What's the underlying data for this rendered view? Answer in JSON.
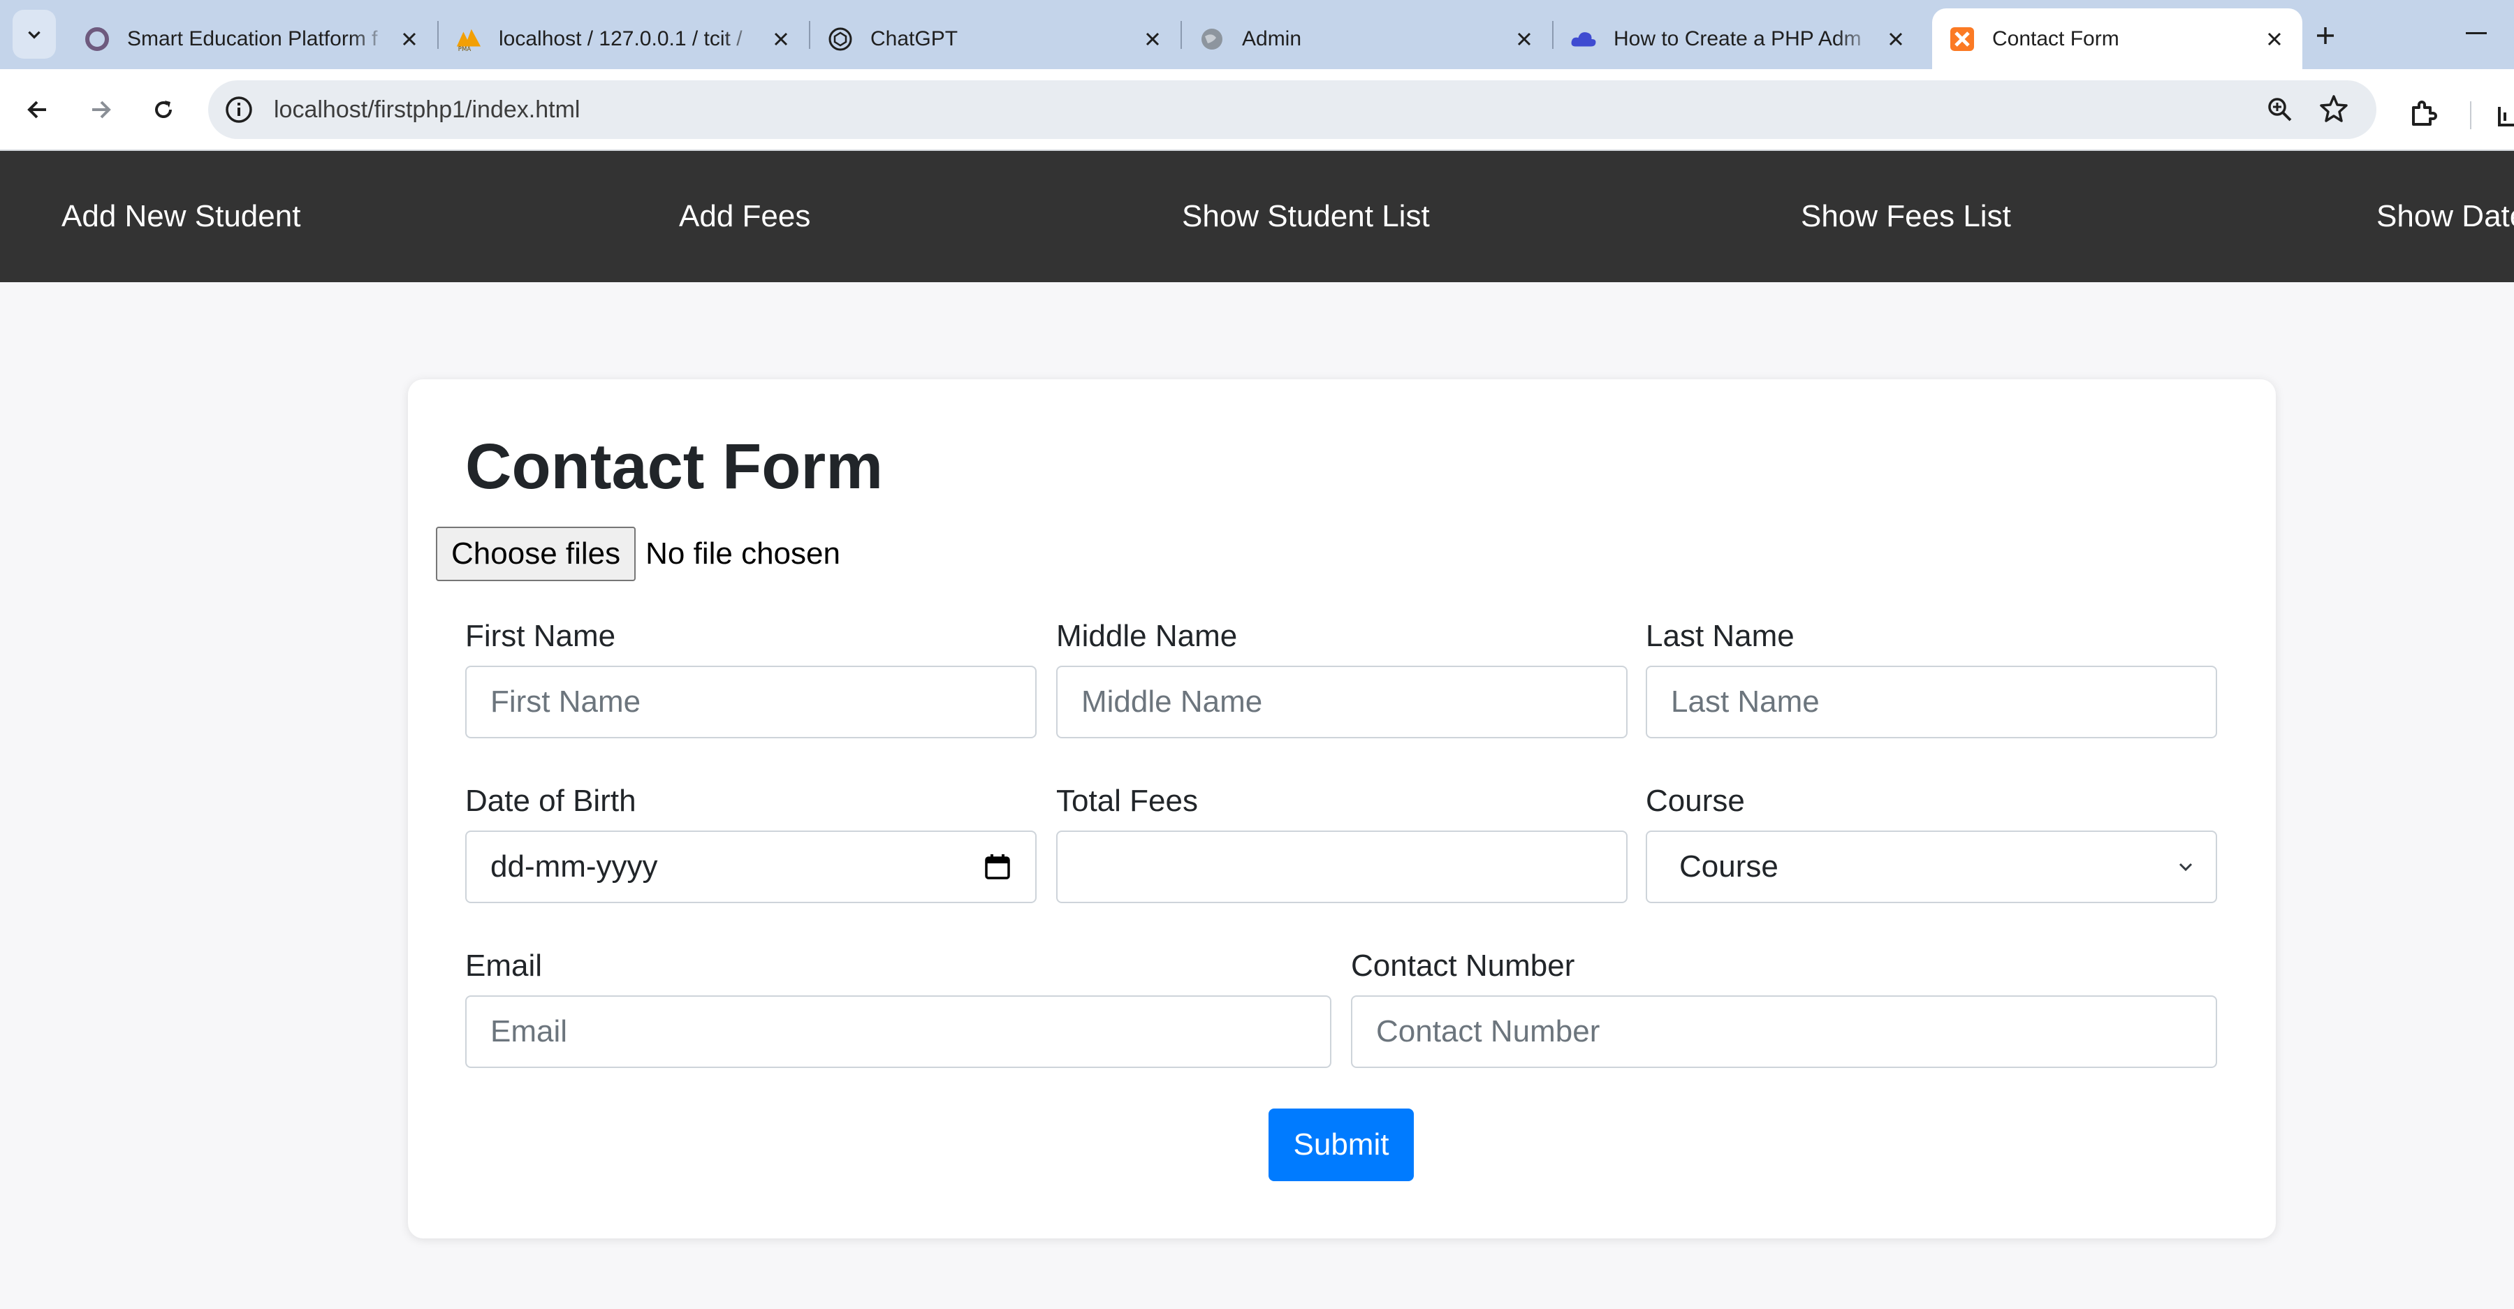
{
  "browser": {
    "tabs": [
      {
        "title": "Smart Education Platform f",
        "icon": "circle-logo-icon",
        "active": false
      },
      {
        "title": "localhost / 127.0.0.1 / tcit /",
        "icon": "phpmyadmin-icon",
        "active": false
      },
      {
        "title": "ChatGPT",
        "icon": "chatgpt-icon",
        "active": false
      },
      {
        "title": "Admin",
        "icon": "globe-icon",
        "active": false
      },
      {
        "title": "How to Create a PHP Adm",
        "icon": "cloud-icon",
        "active": false
      },
      {
        "title": "Contact Form",
        "icon": "xampp-icon",
        "active": true
      }
    ],
    "url": "localhost/firstphp1/index.html"
  },
  "nav": {
    "items": [
      "Add New Student",
      "Add Fees",
      "Show Student List",
      "Show Fees List",
      "Show Date"
    ]
  },
  "form": {
    "title": "Contact Form",
    "file": {
      "button": "Choose files",
      "status": "No file chosen"
    },
    "first_name": {
      "label": "First Name",
      "placeholder": "First Name"
    },
    "middle_name": {
      "label": "Middle Name",
      "placeholder": "Middle Name"
    },
    "last_name": {
      "label": "Last Name",
      "placeholder": "Last Name"
    },
    "dob": {
      "label": "Date of Birth",
      "placeholder": "dd-mm-yyyy"
    },
    "total_fees": {
      "label": "Total Fees",
      "value": ""
    },
    "course": {
      "label": "Course",
      "selected": "Course"
    },
    "email": {
      "label": "Email",
      "placeholder": "Email"
    },
    "contact": {
      "label": "Contact Number",
      "placeholder": "Contact Number"
    },
    "submit": "Submit"
  },
  "colors": {
    "nav_bg": "#333333",
    "primary": "#007bff",
    "tabbar_bg": "#c4d4ea",
    "page_bg": "#f7f7f9"
  }
}
